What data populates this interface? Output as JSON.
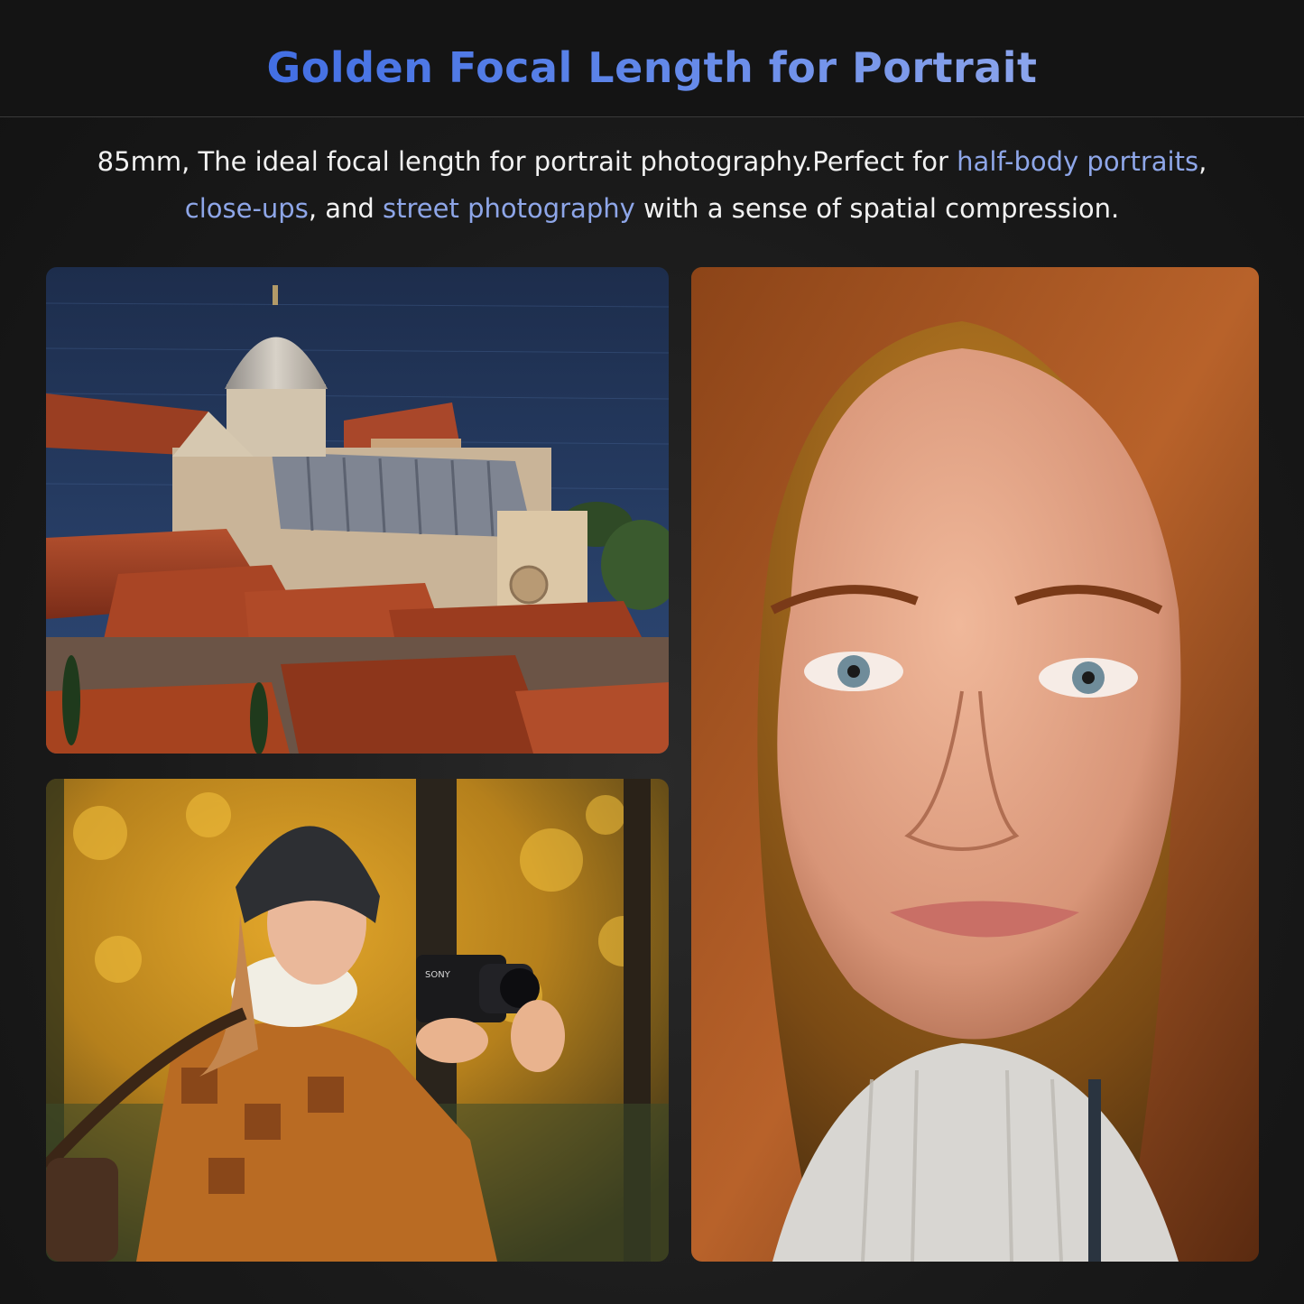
{
  "header": {
    "title": "Golden Focal Length for Portrait"
  },
  "description": {
    "part1": "85mm, The ideal focal length for portrait photography.Perfect for ",
    "highlight1": "half-body portraits",
    "part2": ",",
    "highlight2": "close-ups",
    "part3": ", and ",
    "highlight3": "street photography",
    "part4": " with a sense of spatial compression."
  },
  "camera_brand": "SONY",
  "colors": {
    "title_gradient_start": "#2f5fe0",
    "title_gradient_end": "#a9b9ee",
    "highlight": "#8ea6e8",
    "body_text": "#f2f2f2",
    "background": "#1a1a1a"
  }
}
